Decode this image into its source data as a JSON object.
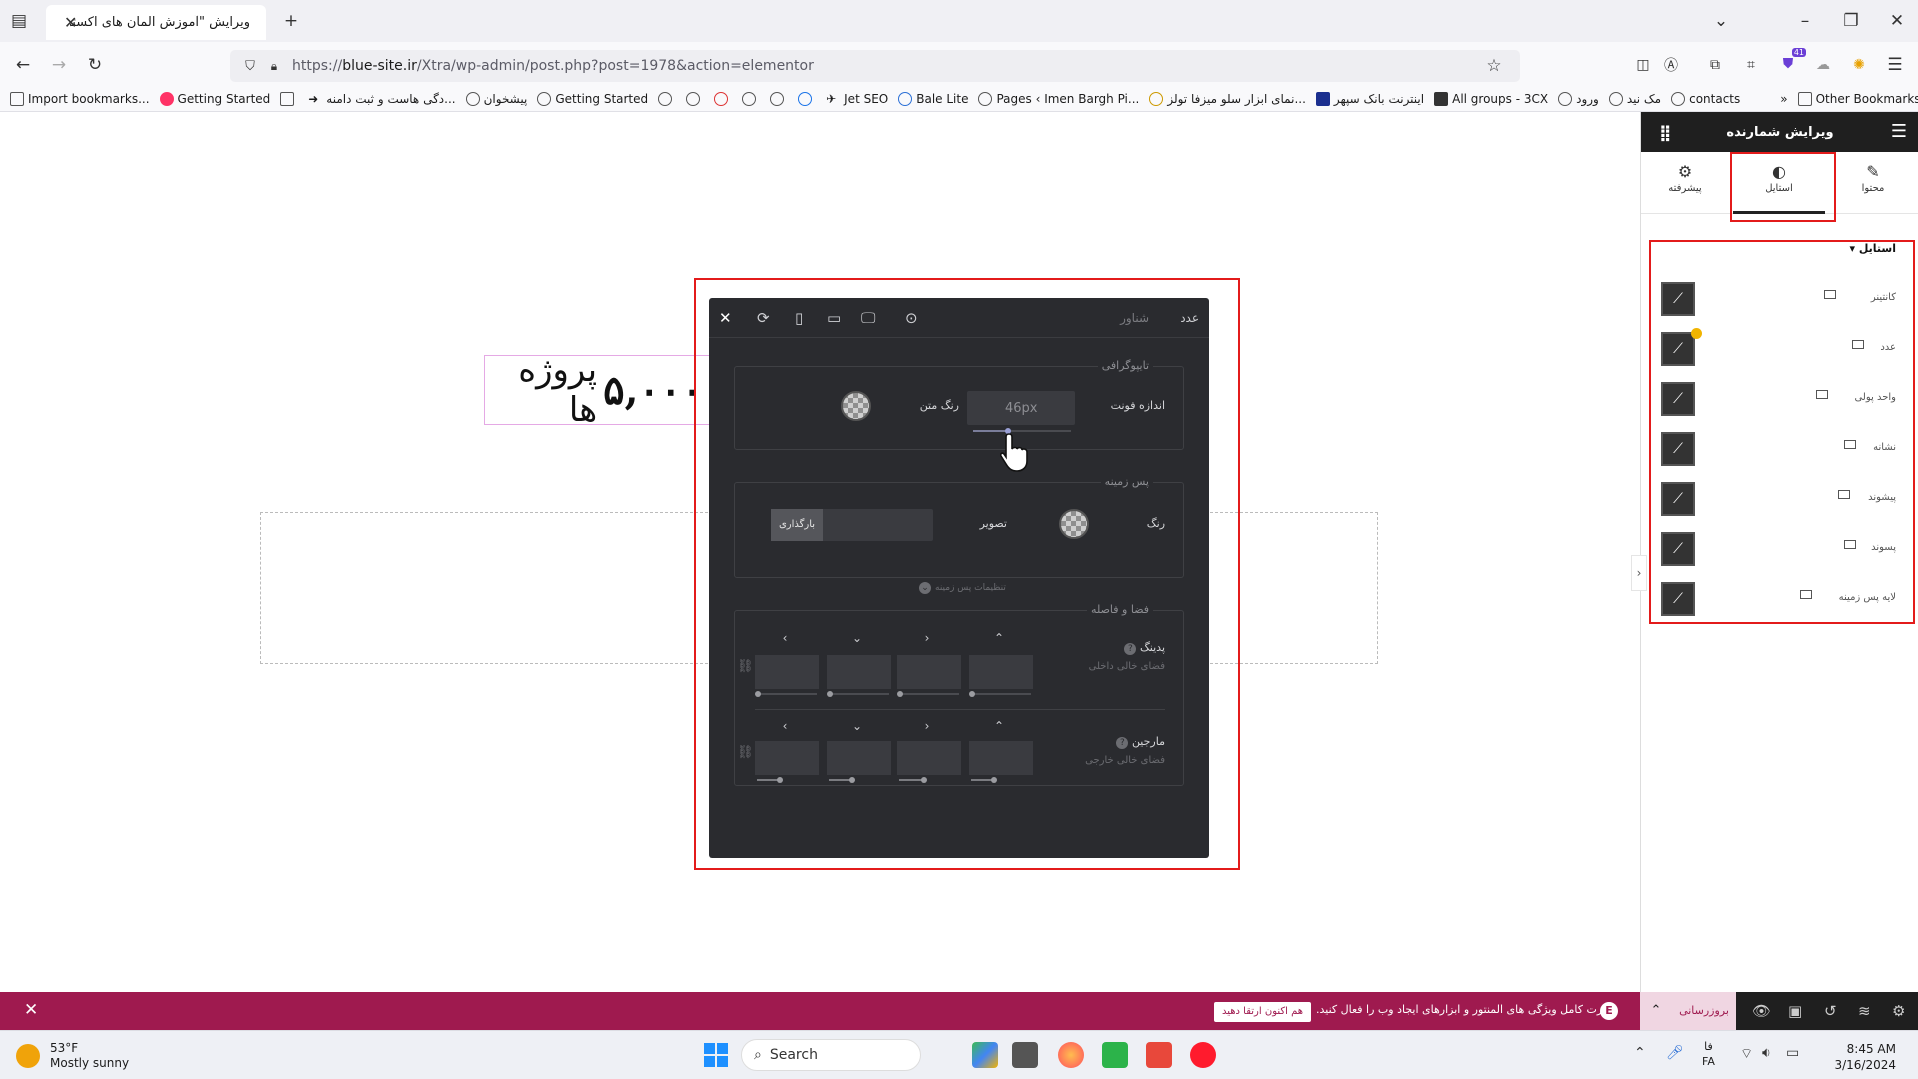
{
  "browser": {
    "tab_title": "ویرایش \"آموزش المان های اکسترا – ما",
    "url_prefix": "https://",
    "url_host": "blue-site.ir",
    "url_path": "/Xtra/wp-admin/post.php?post=1978&action=elementor",
    "bookmarks": [
      "Import bookmarks...",
      "Getting Started",
      "دگی هاست و ثبت دامنه...",
      "پیشخوان",
      "Getting Started",
      "Jet SEO",
      "Bale Lite",
      "Pages ‹ Imen Bargh Pi...",
      "نمای ابزار سلو میزفا تولز...",
      "اینترنت بانک سپهر",
      "All groups - 3CX",
      "ورود",
      "مک نید",
      "contacts"
    ],
    "other_bookmarks": "Other Bookmarks",
    "extension_badge": "41"
  },
  "canvas": {
    "counter_number": "۵,۰۰۰",
    "counter_label": "پروژه ها"
  },
  "popover": {
    "header_title": "عدد",
    "header_sub": "شناور",
    "typography_title": "تایپوگرافی",
    "font_size_label": "اندازه فونت",
    "font_size_value": "46px",
    "text_color_label": "رنگ متن",
    "background_title": "پس زمینه",
    "bg_color_label": "رنگ",
    "bg_image_label": "تصویر",
    "upload_label": "بارگذاری",
    "bg_settings": "تنظیمات پس زمینه",
    "spacing_title": "فضا و فاصله",
    "padding_label": "پدینگ",
    "padding_sub": "فضای خالی داخلی",
    "margin_label": "مارجین",
    "margin_sub": "فضای خالی خارجی"
  },
  "sidebar": {
    "title": "ویرایش شمارنده",
    "tabs": [
      {
        "label": "محتوا",
        "icon": "pencil-icon"
      },
      {
        "label": "استایل",
        "icon": "contrast-icon"
      },
      {
        "label": "پیشرفته",
        "icon": "gear-icon"
      }
    ],
    "accordion_title": "استایل",
    "items": [
      "کانتینر",
      "عدد",
      "واحد پولی",
      "نشانه",
      "پیشوند",
      "پسوند",
      "لایه پس زمینه"
    ]
  },
  "notice": {
    "message": "قدرت کامل ویژگی های المنتور و ابزارهای ایجاد وب را فعال کنید.",
    "button": "هم اکنون ارتقا دهید"
  },
  "editor_bar": {
    "publish": "بروزرسانی"
  },
  "taskbar": {
    "temperature": "53°F",
    "weather": "Mostly sunny",
    "search_placeholder": "Search",
    "lang_top": "فا",
    "lang_bottom": "FA",
    "time": "8:45 AM",
    "date": "3/16/2024"
  }
}
